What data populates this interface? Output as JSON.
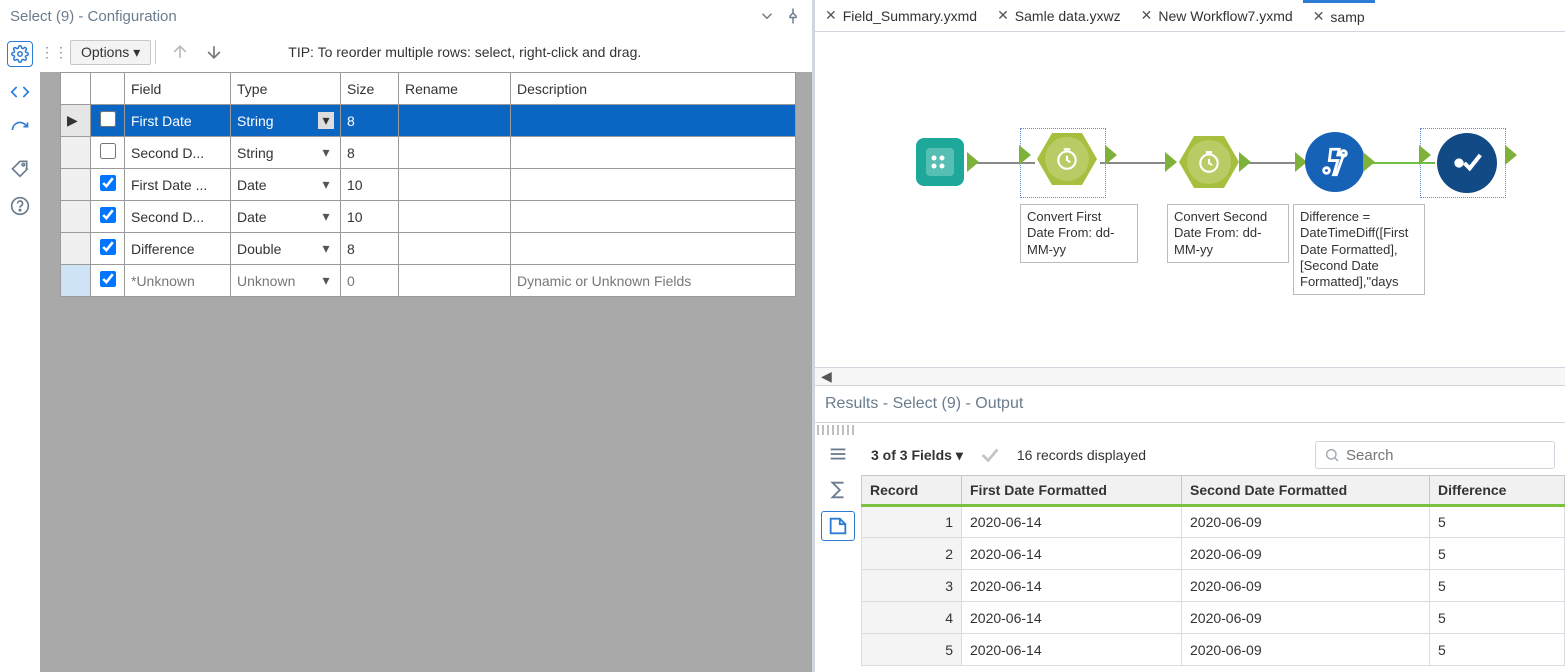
{
  "config": {
    "title": "Select (9) - Configuration",
    "options_label": "Options",
    "tip": "TIP: To reorder multiple rows: select, right-click and drag.",
    "columns": {
      "field": "Field",
      "type": "Type",
      "size": "Size",
      "rename": "Rename",
      "description": "Description"
    },
    "rows": [
      {
        "checked": false,
        "field": "First Date",
        "type": "String",
        "size": "8",
        "rename": "",
        "description": "",
        "selected": true
      },
      {
        "checked": false,
        "field": "Second D...",
        "type": "String",
        "size": "8",
        "rename": "",
        "description": "",
        "selected": false
      },
      {
        "checked": true,
        "field": "First Date ...",
        "type": "Date",
        "size": "10",
        "rename": "",
        "description": "",
        "selected": false
      },
      {
        "checked": true,
        "field": "Second D...",
        "type": "Date",
        "size": "10",
        "rename": "",
        "description": "",
        "selected": false
      },
      {
        "checked": true,
        "field": "Difference",
        "type": "Double",
        "size": "8",
        "rename": "",
        "description": "",
        "selected": false
      },
      {
        "checked": true,
        "field": "*Unknown",
        "type": "Unknown",
        "size": "0",
        "rename": "",
        "description": "Dynamic or Unknown Fields",
        "selected": false,
        "unknown": true
      }
    ]
  },
  "tabs": [
    {
      "label": "Field_Summary.yxmd"
    },
    {
      "label": "Samle data.yxwz"
    },
    {
      "label": "New Workflow7.yxmd"
    },
    {
      "label": "samp",
      "active": true
    }
  ],
  "canvas": {
    "labels": {
      "conv1": "Convert First Date From: dd-MM-yy",
      "conv2": "Convert Second Date From: dd-MM-yy",
      "formula": "Difference = DateTimeDiff([First Date Formatted],[Second Date Formatted],\"days"
    }
  },
  "results": {
    "title": "Results - Select (9) - Output",
    "fields_summary": "3 of 3 Fields",
    "records_summary": "16 records displayed",
    "search_placeholder": "Search",
    "columns": {
      "record": "Record",
      "a": "First Date Formatted",
      "b": "Second Date Formatted",
      "c": "Difference"
    },
    "rows": [
      {
        "rec": "1",
        "a": "2020-06-14",
        "b": "2020-06-09",
        "c": "5"
      },
      {
        "rec": "2",
        "a": "2020-06-14",
        "b": "2020-06-09",
        "c": "5"
      },
      {
        "rec": "3",
        "a": "2020-06-14",
        "b": "2020-06-09",
        "c": "5"
      },
      {
        "rec": "4",
        "a": "2020-06-14",
        "b": "2020-06-09",
        "c": "5"
      },
      {
        "rec": "5",
        "a": "2020-06-14",
        "b": "2020-06-09",
        "c": "5"
      }
    ]
  }
}
